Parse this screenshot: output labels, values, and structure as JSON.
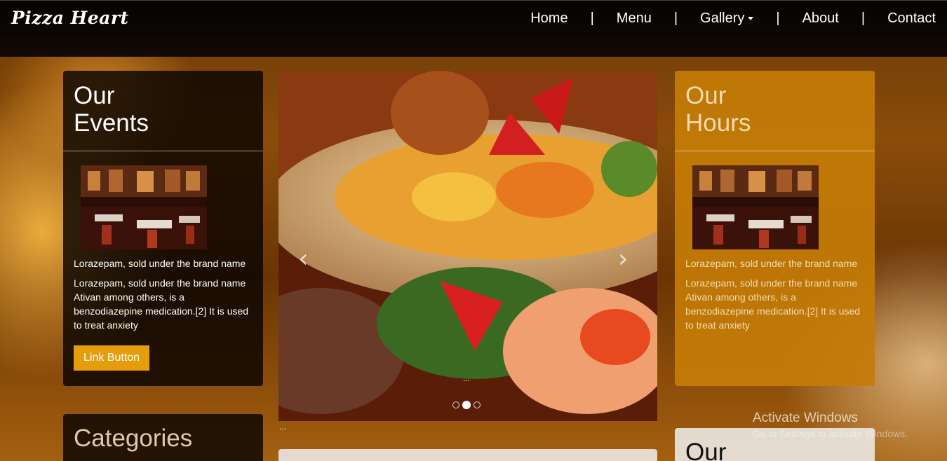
{
  "nav": {
    "brand": "Pizza Heart",
    "items": [
      {
        "label": "Home"
      },
      {
        "label": "Menu"
      },
      {
        "label": "Gallery"
      },
      {
        "label": "About"
      },
      {
        "label": "Contact"
      }
    ],
    "separator": "|"
  },
  "events": {
    "title_line1": "Our",
    "title_line2": "Events",
    "caption": "Lorazepam, sold under the brand name",
    "body": "Lorazepam, sold under the brand name Ativan among others, is a benzodiazepine medication.[2] It is used to treat anxiety",
    "button_label": "Link Button"
  },
  "hours": {
    "title_line1": "Our",
    "title_line2": "Hours",
    "caption": "Lorazepam, sold under the brand name",
    "body": "Lorazepam, sold under the brand name Ativan among others, is a benzodiazepine medication.[2] It is used to treat anxiety"
  },
  "carousel": {
    "prev_icon": "‹",
    "next_icon": "›",
    "caption": "...",
    "below_caption": "...",
    "active_index": 1,
    "slide_count": 3
  },
  "categories": {
    "title": "Categories"
  },
  "lower_right": {
    "title": "Our"
  },
  "watermark": {
    "line1": "Activate Windows",
    "line2": "Go to Settings to activate Windows."
  }
}
